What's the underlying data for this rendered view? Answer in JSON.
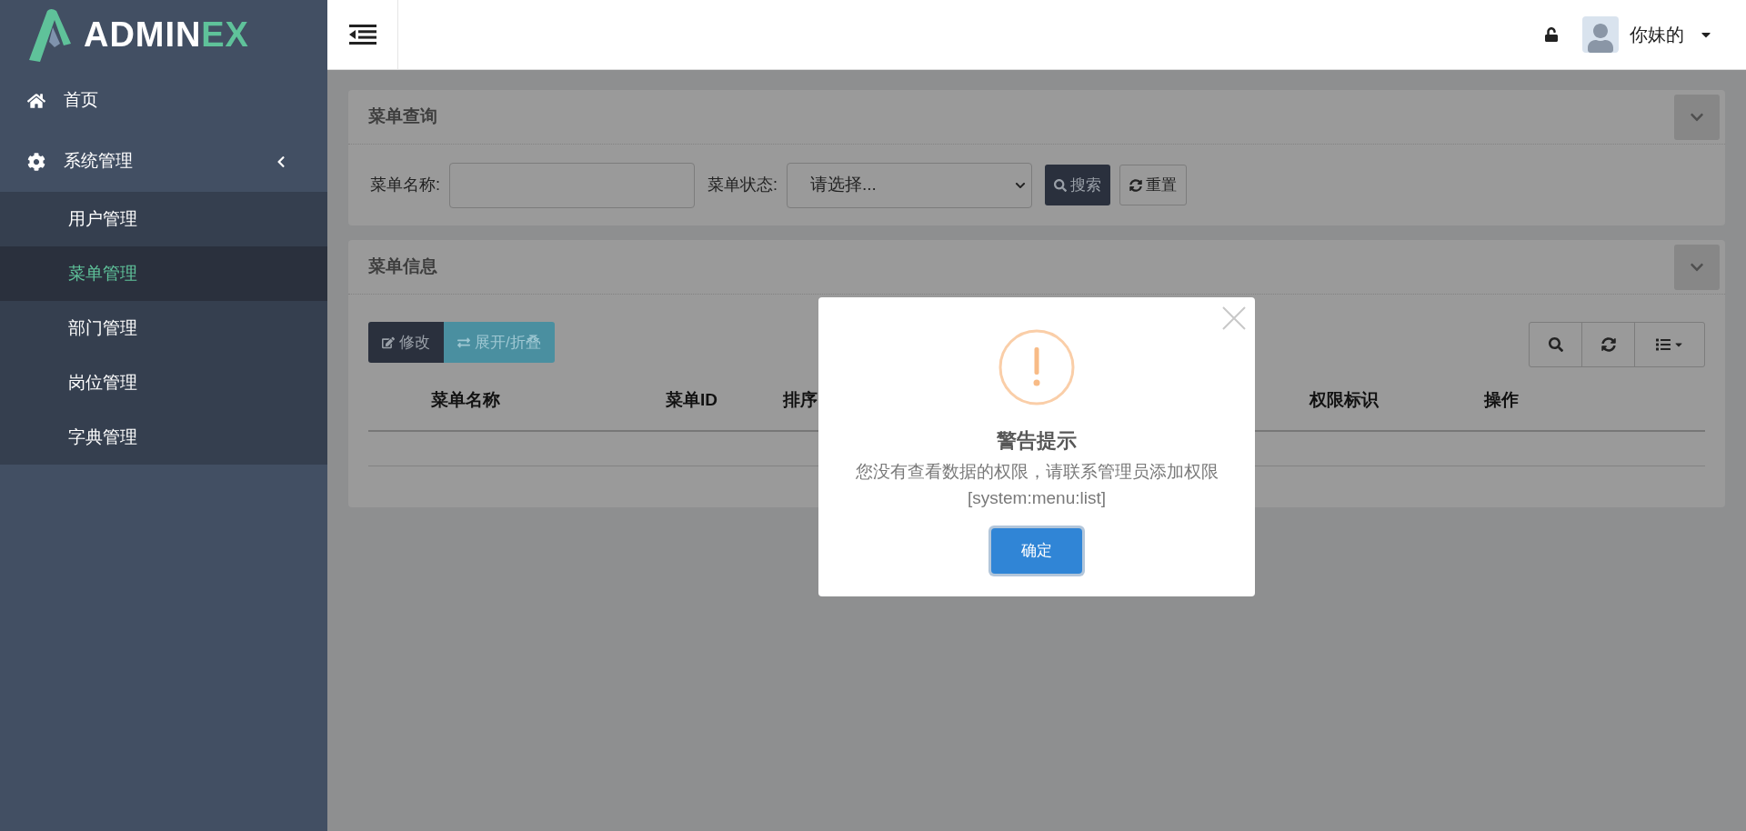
{
  "logo": {
    "text_main": "ADMIN",
    "text_accent": "EX"
  },
  "sidebar": {
    "items": [
      {
        "label": "首页",
        "kind": "home",
        "selected": false
      },
      {
        "label": "系统管理",
        "kind": "settings",
        "selected": false,
        "expanded": true,
        "children": [
          {
            "label": "用户管理",
            "selected": false
          },
          {
            "label": "菜单管理",
            "selected": true
          },
          {
            "label": "部门管理",
            "selected": false
          },
          {
            "label": "岗位管理",
            "selected": false
          },
          {
            "label": "字典管理",
            "selected": false
          }
        ]
      }
    ]
  },
  "topbar": {
    "user_name": "你妹的"
  },
  "query_panel": {
    "title": "菜单查询",
    "name_label": "菜单名称:",
    "status_label": "菜单状态:",
    "status_placeholder": "请选择...",
    "search_button": "搜索",
    "reset_button": "重置"
  },
  "info_panel": {
    "title": "菜单信息",
    "edit_button": "修改",
    "toggle_button": "展开/折叠",
    "columns": [
      "菜单名称",
      "菜单ID",
      "排序",
      "权限标识",
      "操作"
    ]
  },
  "dialog": {
    "title": "警告提示",
    "message": "您没有查看数据的权限，请联系管理员添加权限",
    "detail": "[system:menu:list]",
    "confirm_button": "确定"
  }
}
